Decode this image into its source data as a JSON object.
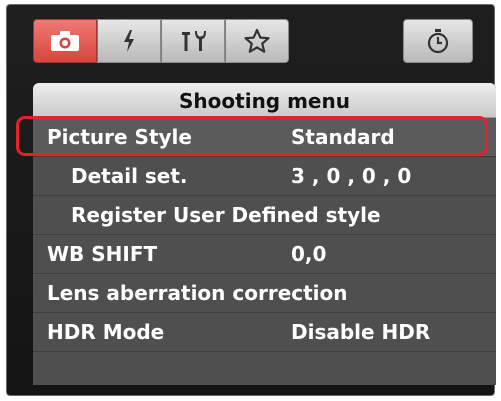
{
  "tabs": [
    {
      "icon": "camera-icon",
      "active": true
    },
    {
      "icon": "flash-icon",
      "active": false
    },
    {
      "icon": "tools-icon",
      "active": false
    },
    {
      "icon": "star-icon",
      "active": false
    }
  ],
  "timer_tab": {
    "icon": "timer-icon"
  },
  "menu": {
    "title": "Shooting menu",
    "rows": [
      {
        "label": "Picture Style",
        "value": "Standard"
      },
      {
        "label": "Detail set.",
        "value": "3 , 0 , 0 , 0"
      },
      {
        "label": "Register User Defined style",
        "value": ""
      },
      {
        "label": "WB SHIFT",
        "value": "0,0"
      },
      {
        "label": "Lens aberration correction",
        "value": ""
      },
      {
        "label": "HDR Mode",
        "value": "Disable HDR"
      }
    ]
  },
  "colors": {
    "active_tab": "#e0504a",
    "highlight": "#e2232a",
    "panel": "#4f4f4f",
    "window": "#1a1a1a"
  }
}
